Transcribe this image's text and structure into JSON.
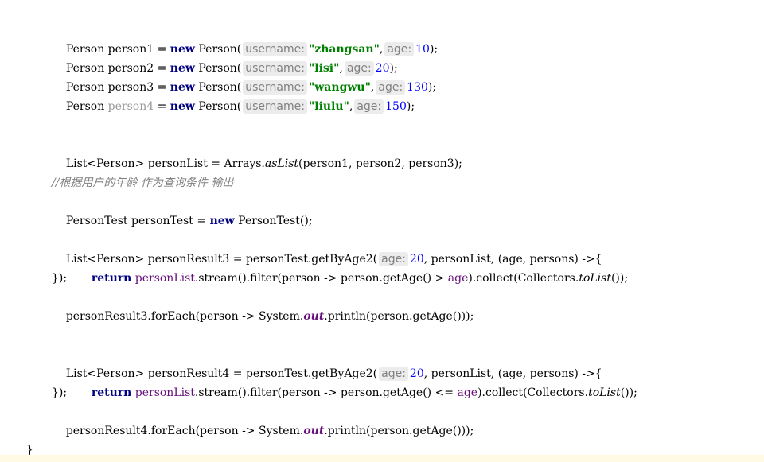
{
  "code": {
    "l1": {
      "type": "Person",
      "var": "person1",
      "eq": "=",
      "new": "new",
      "ctor": "Person(",
      "hint_username": "username:",
      "str": "\"zhangsan\"",
      "comma": ",",
      "hint_age": "age:",
      "num": "10",
      "end": ");"
    },
    "l2": {
      "type": "Person",
      "var": "person2",
      "eq": "=",
      "new": "new",
      "ctor": "Person(",
      "hint_username": "username:",
      "str": "\"lisi\"",
      "comma": ",",
      "hint_age": "age:",
      "num": "20",
      "end": ");"
    },
    "l3": {
      "type": "Person",
      "var": "person3",
      "eq": "=",
      "new": "new",
      "ctor": "Person(",
      "hint_username": "username:",
      "str": "\"wangwu\"",
      "comma": ",",
      "hint_age": "age:",
      "num": "130",
      "end": ");"
    },
    "l4": {
      "type": "Person",
      "var": "person4",
      "eq": "=",
      "new": "new",
      "ctor": "Person(",
      "hint_username": "username:",
      "str": "\"liulu\"",
      "comma": ",",
      "hint_age": "age:",
      "num": "150",
      "end": ");"
    },
    "l5": {
      "pre": "List<Person> personList = Arrays.",
      "method": "asList",
      "post": "(person1, person2, person3);"
    },
    "l6": {
      "comment": "//根据用户的年龄 作为查询条件 输出"
    },
    "l7": {
      "pre": "PersonTest personTest = ",
      "new": "new",
      "post": " PersonTest();"
    },
    "l8": {
      "pre": "List<Person> personResult3 = personTest.getByAge2(",
      "hint_age": "age:",
      "num": "20",
      "post": ", personList, (age, persons) ->{"
    },
    "l9": {
      "ret": "return",
      "field": "personList",
      "mid": ".stream().filter(person -> person.getAge() > ",
      "age": "age",
      "tail1": ").collect(Collectors.",
      "method": "toList",
      "tail2": "());"
    },
    "l10": {
      "text": "});"
    },
    "l11": {
      "pre": "personResult3.forEach(person -> System.",
      "field": "out",
      "post": ".println(person.getAge()));"
    },
    "l12": {
      "pre": "List<Person> personResult4 = personTest.getByAge2(",
      "hint_age": "age:",
      "num": "20",
      "post": ", personList, (age, persons) ->{"
    },
    "l13": {
      "ret": "return",
      "field": "personList",
      "mid": ".stream().filter(person -> person.getAge() <= ",
      "age": "age",
      "tail1": ").collect(Collectors.",
      "method": "toList",
      "tail2": "());"
    },
    "l14": {
      "text": "});"
    },
    "l15": {
      "pre": "personResult4.forEach(person -> System.",
      "field": "out",
      "post": ".println(person.getAge()));"
    },
    "l16": {
      "text": "}"
    }
  },
  "colors": {
    "keyword": "#000080",
    "string": "#008000",
    "number": "#0000ff",
    "field": "#660e7a",
    "comment": "#808080",
    "hint_bg": "#ececec",
    "caret_row": "#fffae3"
  }
}
